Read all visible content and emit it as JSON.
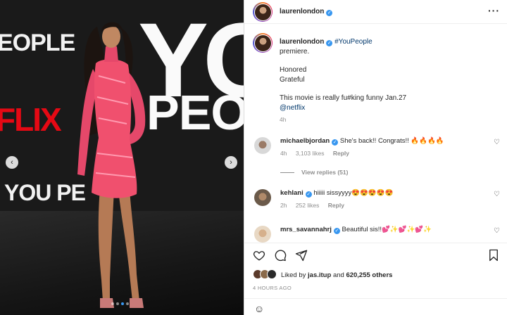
{
  "post": {
    "username": "laurenlondon",
    "more_icon": "more-horizontal-icon",
    "caption": {
      "hashtag": "#YouPeople",
      "lines": [
        "premiere.",
        "Honored",
        "Grateful",
        "This movie is really fu#king funny Jan.27"
      ],
      "mention": "@netflix",
      "time": "4h"
    }
  },
  "photo": {
    "backdrop_texts": [
      "EOPLE",
      "FLIX",
      "YOU PE",
      "YO",
      "PEO"
    ],
    "slide_count": 4,
    "active_slide": 2
  },
  "comments": [
    {
      "username": "michaelbjordan",
      "verified": true,
      "text": "She's back!! Congrats!! 🔥🔥🔥🔥",
      "time": "4h",
      "likes": "3,103 likes",
      "reply": "Reply"
    },
    {
      "username": "kehlani",
      "verified": true,
      "text": "hiiiii sissyyyy😍😍😍😍😍",
      "time": "2h",
      "likes": "252 likes",
      "reply": "Reply"
    },
    {
      "username": "mrs_savannahrj",
      "verified": true,
      "text": "Beautiful sis!!💕✨💕✨💕✨"
    }
  ],
  "view_replies": "View replies (51)",
  "likes": {
    "prefix": "Liked by",
    "user": "jas.itup",
    "middle": "and",
    "count": "620,255 others"
  },
  "timestamp": "4 HOURS AGO",
  "icons": {
    "like": "heart-icon",
    "comment": "comment-icon",
    "share": "share-icon",
    "save": "bookmark-icon",
    "emoji": "emoji-icon"
  },
  "colors": {
    "verified": "#3897f0",
    "link": "#00376b",
    "netflix": "#e50914",
    "dress": "#f0506e"
  }
}
